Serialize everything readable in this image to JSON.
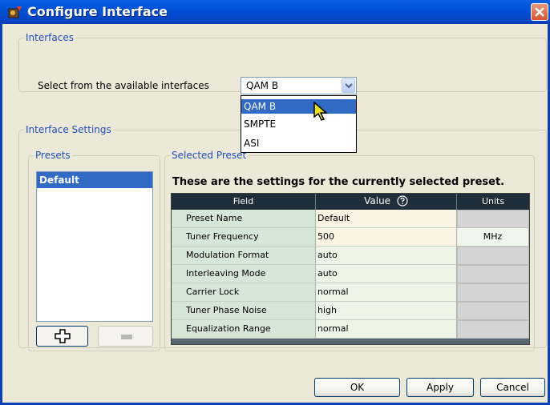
{
  "window": {
    "title": "Configure Interface"
  },
  "interfaces": {
    "legend": "Interfaces",
    "select_label": "Select from the available interfaces",
    "selected": "QAM B",
    "options": [
      "QAM B",
      "SMPTE",
      "ASI"
    ]
  },
  "settings": {
    "legend": "Interface Settings",
    "presets": {
      "legend": "Presets",
      "items": [
        "Default"
      ]
    },
    "selected_preset": {
      "legend": "Selected Preset",
      "heading": "These are the settings for the currently selected preset.",
      "columns": {
        "field": "Field",
        "value": "Value",
        "units": "Units"
      },
      "rows": [
        {
          "field": "Preset Name",
          "value": "Default",
          "units": ""
        },
        {
          "field": "Tuner Frequency",
          "value": "500",
          "units": "MHz"
        },
        {
          "field": "Modulation Format",
          "value": "auto",
          "units": ""
        },
        {
          "field": "Interleaving Mode",
          "value": "auto",
          "units": ""
        },
        {
          "field": "Carrier Lock",
          "value": "normal",
          "units": ""
        },
        {
          "field": "Tuner Phase Noise",
          "value": "high",
          "units": ""
        },
        {
          "field": "Equalization Range",
          "value": "normal",
          "units": ""
        }
      ]
    }
  },
  "buttons": {
    "ok": "OK",
    "apply": "Apply",
    "cancel": "Cancel"
  },
  "icons": {
    "app": "app-icon",
    "close": "close-icon",
    "add": "plus-icon",
    "remove": "minus-icon",
    "help": "help-icon",
    "dropdown": "chevron-down-icon"
  }
}
